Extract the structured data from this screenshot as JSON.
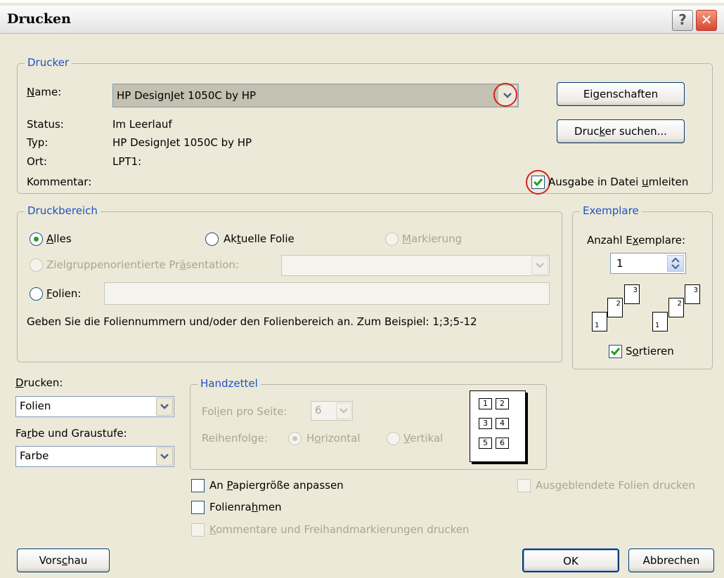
{
  "window": {
    "title": "Drucken",
    "help_label": "?",
    "close_label": "✕"
  },
  "printer": {
    "legend": "Drucker",
    "name_label": "Name:",
    "name_value": "HP DesignJet 1050C by HP",
    "status_label": "Status:",
    "status_value": "Im Leerlauf",
    "type_label": "Typ:",
    "type_value": "HP DesignJet 1050C by HP",
    "location_label": "Ort:",
    "location_value": "LPT1:",
    "comment_label": "Kommentar:",
    "comment_value": "",
    "properties_button": "Eigenschaften",
    "find_button": "Drucker suchen...",
    "print_to_file_label": "Ausgabe in Datei umleiten",
    "print_to_file_checked": true
  },
  "range": {
    "legend": "Druckbereich",
    "all_label": "Alles",
    "current_label": "Aktuelle Folie",
    "selection_label": "Markierung",
    "custom_show_label": "Zielgruppenorientierte Präsentation:",
    "custom_show_value": "",
    "slides_label": "Folien:",
    "slides_value": "",
    "hint": "Geben Sie die Foliennummern und/oder den Folienbereich an. Zum Beispiel: 1;3;5-12"
  },
  "copies": {
    "legend": "Exemplare",
    "count_label": "Anzahl Exemplare:",
    "count_value": "1",
    "collate_label": "Sortieren",
    "collate_checked": true,
    "collate_pages": [
      "1",
      "2",
      "3"
    ]
  },
  "print_what": {
    "label": "Drucken:",
    "value": "Folien"
  },
  "color": {
    "label": "Farbe und Graustufe:",
    "value": "Farbe"
  },
  "handouts": {
    "legend": "Handzettel",
    "slides_per_page_label": "Folien pro Seite:",
    "slides_per_page_value": "6",
    "order_label": "Reihenfolge:",
    "horizontal_label": "Horizontal",
    "vertical_label": "Vertikal",
    "preview_cells": [
      "1",
      "2",
      "3",
      "4",
      "5",
      "6"
    ]
  },
  "options": {
    "fit_label": "An Papiergröße anpassen",
    "frame_label": "Folienrahmen",
    "comments_label": "Kommentare und Freihandmarkierungen drucken",
    "hidden_label": "Ausgeblendete Folien drucken"
  },
  "footer": {
    "preview_button": "Vorschau",
    "ok_button": "OK",
    "cancel_button": "Abbrechen"
  },
  "colors": {
    "dialog_bg": "#ECE9D8",
    "legend_blue": "#1f52c1",
    "highlight_ring": "#d42020",
    "check_green": "#21a121"
  }
}
